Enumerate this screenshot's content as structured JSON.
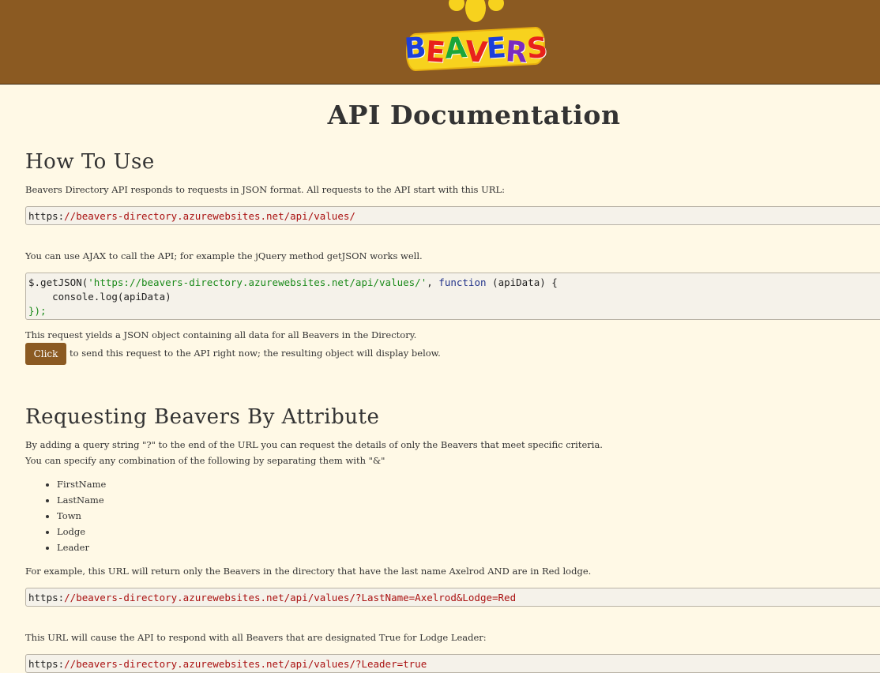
{
  "header": {
    "logo_text": "BEAVERS",
    "logo_letters": [
      {
        "ch": "B",
        "color": "#1c3fd8"
      },
      {
        "ch": "E",
        "color": "#e8221b"
      },
      {
        "ch": "A",
        "color": "#1ba63a"
      },
      {
        "ch": "V",
        "color": "#e8221b"
      },
      {
        "ch": "E",
        "color": "#1c3fd8"
      },
      {
        "ch": "R",
        "color": "#7a2bbf"
      },
      {
        "ch": "S",
        "color": "#e8221b"
      }
    ]
  },
  "title": "API Documentation",
  "how_to_use": {
    "heading": "How To Use",
    "intro": "Beavers Directory API responds to requests in JSON format. All requests to the API start with this URL:",
    "base_url_prefix": "https:",
    "base_url_rest": "//beavers-directory.azurewebsites.net/api/values/",
    "ajax_text": "You can use AJAX to call the API; for example the jQuery method getJSON works well.",
    "code_line1_a": "$.getJSON(",
    "code_line1_str": "'https://beavers-directory.azurewebsites.net/api/values/'",
    "code_line1_b": ", ",
    "code_line1_kw": "function",
    "code_line1_c": " (apiData) {",
    "code_line2": "    console.log(apiData)",
    "code_line3": "});",
    "yields_text": "This request yields a JSON object containing all data for all Beavers in the Directory.",
    "click_label": "Click",
    "click_text": "to send this request to the API right now; the resulting object will display below."
  },
  "by_attribute": {
    "heading": "Requesting Beavers By Attribute",
    "line1": "By adding a query string \"?\" to the end of the URL you can request the details of only the Beavers that meet specific criteria.",
    "line2": "You can specify any combination of the following by separating them with \"&\"",
    "attributes": [
      "FirstName",
      "LastName",
      "Town",
      "Lodge",
      "Leader"
    ],
    "example_text": "For example, this URL will return only the Beavers in the directory that have the last name Axelrod AND are in Red lodge.",
    "example_url_prefix": "https:",
    "example_url_rest": "//beavers-directory.azurewebsites.net/api/values/?LastName=Axelrod&Lodge=Red",
    "leader_text": "This URL will cause the API to respond with all Beavers that are designated True for Lodge Leader:",
    "leader_url_prefix": "https:",
    "leader_url_rest": "//beavers-directory.azurewebsites.net/api/values/?Leader=true"
  }
}
